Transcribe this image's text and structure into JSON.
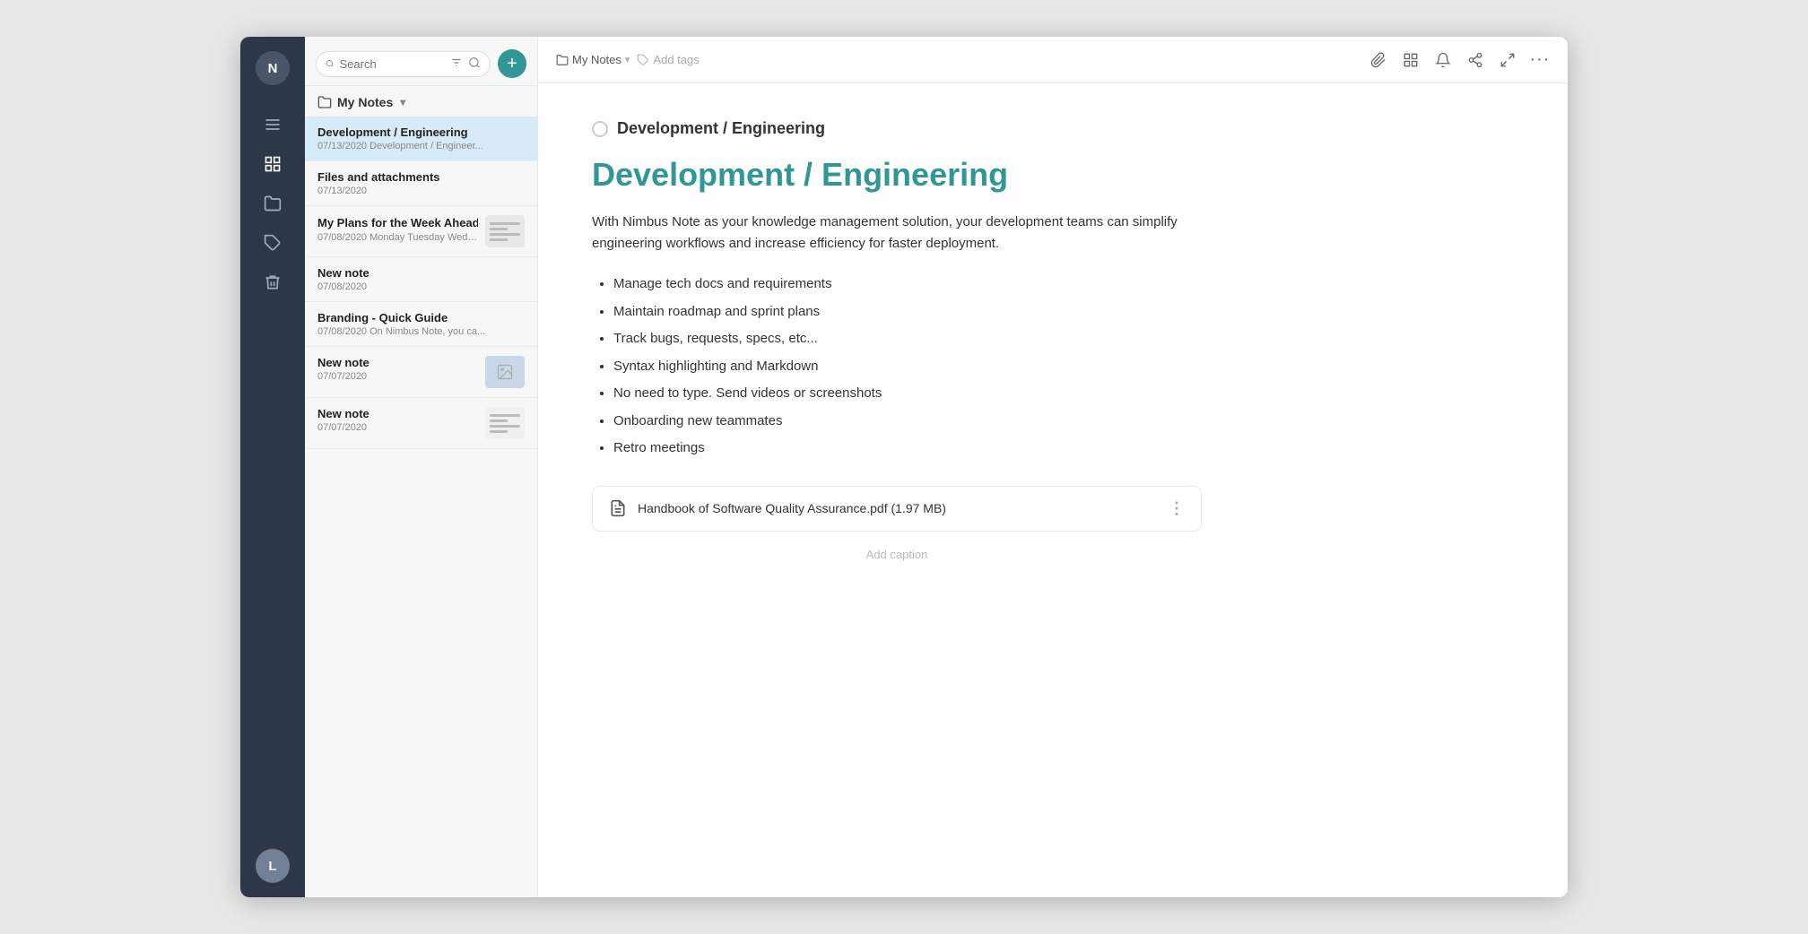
{
  "app": {
    "title": "Nimbus Note"
  },
  "sidebar": {
    "user_initial": "N",
    "bottom_initial": "L",
    "icons": [
      "hamburger",
      "grid",
      "folder",
      "tag",
      "trash"
    ]
  },
  "search": {
    "placeholder": "Search",
    "value": ""
  },
  "add_button_label": "+",
  "folder": {
    "name": "My Notes",
    "icon": "folder-icon",
    "chevron": "▾"
  },
  "notes": [
    {
      "id": "1",
      "title": "Development / Engineering",
      "date": "07/13/2020",
      "preview": "Development / Engineer...",
      "active": true,
      "has_thumbnail": false
    },
    {
      "id": "2",
      "title": "Files and attachments",
      "date": "07/13/2020",
      "preview": "",
      "active": false,
      "has_thumbnail": false
    },
    {
      "id": "3",
      "title": "My Plans for the Week Ahead",
      "date": "07/08/2020",
      "preview": "Monday Tuesday Wedne...",
      "active": false,
      "has_thumbnail": true,
      "thumb_type": "doc"
    },
    {
      "id": "4",
      "title": "New note",
      "date": "07/08/2020",
      "preview": "",
      "active": false,
      "has_thumbnail": false
    },
    {
      "id": "5",
      "title": "Branding - Quick Guide",
      "date": "07/08/2020",
      "preview": "On Nimbus Note, you ca...",
      "active": false,
      "has_thumbnail": false
    },
    {
      "id": "6",
      "title": "New note",
      "date": "07/07/2020",
      "preview": "",
      "active": false,
      "has_thumbnail": true,
      "thumb_type": "image"
    },
    {
      "id": "7",
      "title": "New note",
      "date": "07/07/2020",
      "preview": "",
      "active": false,
      "has_thumbnail": true,
      "thumb_type": "lines"
    }
  ],
  "editor": {
    "breadcrumb_folder": "My Notes",
    "breadcrumb_chevron": "▾",
    "add_tags_label": "Add tags",
    "page_title": "Development / Engineering",
    "heading": "Development / Engineering",
    "intro": "With Nimbus Note as your knowledge management solution, your development teams can simplify engineering workflows and increase efficiency for faster deployment.",
    "list_items": [
      "Manage tech docs and requirements",
      "Maintain roadmap and sprint plans",
      "Track bugs, requests, specs, etc...",
      "Syntax highlighting and Markdown",
      "No need to type. Send videos or screenshots",
      "Onboarding new teammates",
      "Retro meetings"
    ],
    "attachment": {
      "name": "Handbook of Software Quality Assurance.pdf (1.97 MB)"
    },
    "attachment_caption": "Add caption"
  },
  "toolbar_icons": [
    "paperclip",
    "grid",
    "bell",
    "share",
    "expand",
    "more"
  ]
}
